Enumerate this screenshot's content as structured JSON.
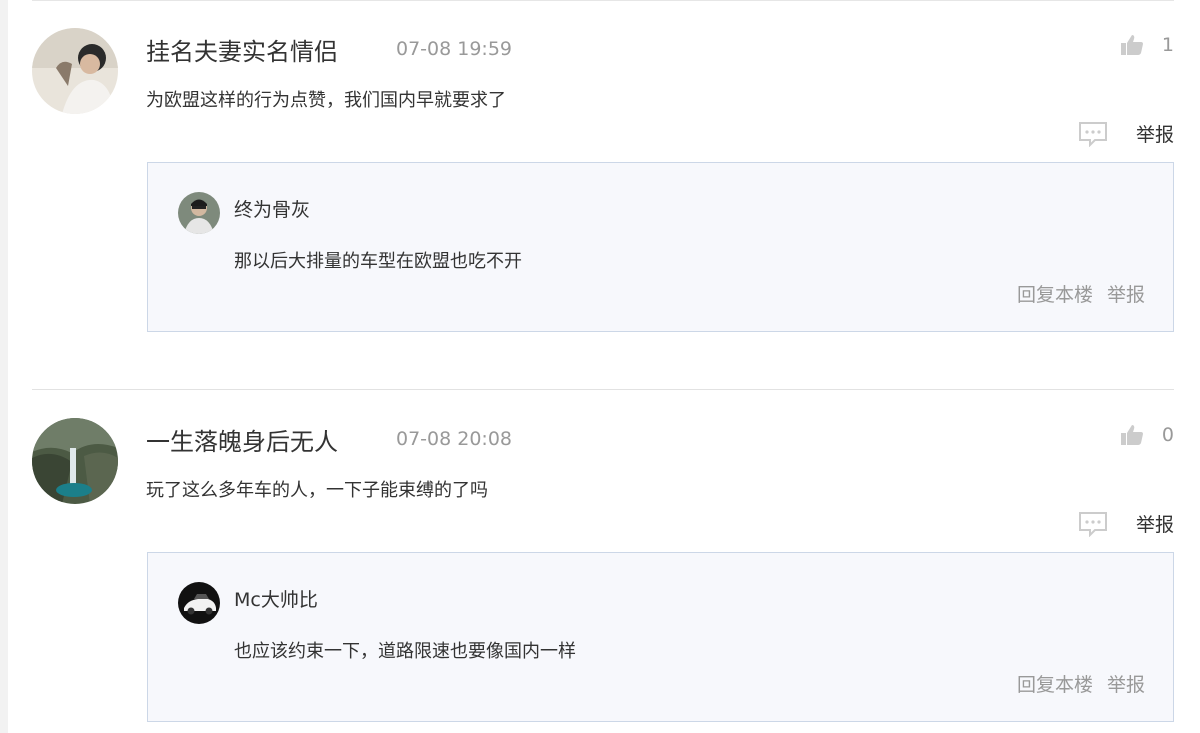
{
  "comments": [
    {
      "username": "挂名夫妻实名情侣",
      "time": "07-08 19:59",
      "likes": "1",
      "text": "为欧盟这样的行为点赞，我们国内早就要求了",
      "report_label": "举报",
      "reply": {
        "username": "终为骨灰",
        "text": "那以后大排量的车型在欧盟也吃不开",
        "reply_label": "回复本楼",
        "report_label": "举报"
      }
    },
    {
      "username": "一生落魄身后无人",
      "time": "07-08 20:08",
      "likes": "0",
      "text": "玩了这么多年车的人，一下子能束缚的了吗",
      "report_label": "举报",
      "reply": {
        "username": "Mc大帅比",
        "text": "也应该约束一下，道路限速也要像国内一样",
        "reply_label": "回复本楼",
        "report_label": "举报"
      }
    }
  ],
  "icons": {
    "like": "thumbs-up-icon",
    "reply": "message-icon"
  },
  "colors": {
    "reply_bg": "#f7f8fc",
    "reply_border": "#ccd7e7",
    "muted_text": "#999999"
  }
}
